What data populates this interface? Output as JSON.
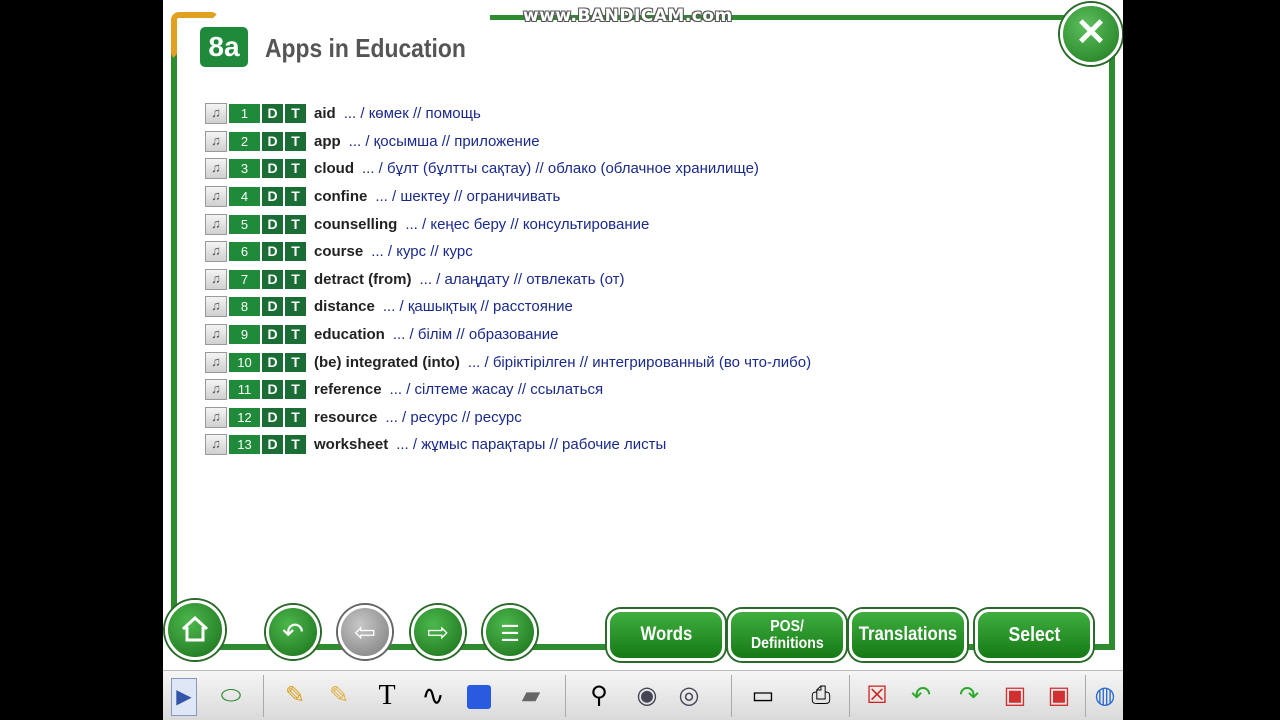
{
  "watermark": "www.BANDICAM.com",
  "unit": {
    "badge": "8a",
    "title": "Apps in Education"
  },
  "row_buttons": {
    "definition": "D",
    "translation": "T",
    "audio_icon": "headphones-icon"
  },
  "words": [
    {
      "num": "1",
      "word": "aid",
      "translation": "... / көмек // помощь"
    },
    {
      "num": "2",
      "word": "app",
      "translation": "... / қосымша // приложение"
    },
    {
      "num": "3",
      "word": "cloud",
      "translation": "... / бұлт (бұлтты сақтау) // облако (облачное хранилище)"
    },
    {
      "num": "4",
      "word": "confine",
      "translation": "... / шектеу // ограничивать"
    },
    {
      "num": "5",
      "word": "counselling",
      "translation": "... / кеңес беру // консультирование"
    },
    {
      "num": "6",
      "word": "course",
      "translation": "... / курс // курс"
    },
    {
      "num": "7",
      "word": "detract (from)",
      "translation": "... / алаңдату // отвлекать (от)"
    },
    {
      "num": "8",
      "word": "distance",
      "translation": "... / қашықтық // расстояние"
    },
    {
      "num": "9",
      "word": "education",
      "translation": "... / білім // образование"
    },
    {
      "num": "10",
      "word": "(be) integrated (into)",
      "translation": "... / біріктірілген // интегрированный (во что-либо)"
    },
    {
      "num": "11",
      "word": "reference",
      "translation": "... / сілтеме жасау // ссылаться"
    },
    {
      "num": "12",
      "word": "resource",
      "translation": "... / ресурс // ресурс"
    },
    {
      "num": "13",
      "word": "worksheet",
      "translation": "... / жұмыс парақтары // рабочие листы"
    }
  ],
  "nav": {
    "home_icon": "home-icon",
    "undo_icon": "undo-arrow-icon",
    "back_icon": "left-arrow-icon",
    "forward_icon": "right-arrow-icon",
    "clear_icon": "clear-list-icon",
    "close_icon": "close-icon"
  },
  "modes": {
    "words": "Words",
    "pos_line1": "POS/",
    "pos_line2": "Definitions",
    "translations": "Translations",
    "select": "Select"
  },
  "toolbar": {
    "icons": [
      "expand-arrow-icon",
      "mouse-pointer-icon",
      "pencil-icon",
      "highlighter-icon",
      "text-tool-icon",
      "freehand-icon",
      "shape-icon",
      "eraser-icon",
      "zoom-icon",
      "reveal-icon",
      "hide-icon",
      "blank-page-icon",
      "print-icon",
      "delete-icon",
      "undo-icon",
      "redo-icon",
      "save-icon",
      "save-as-icon",
      "globe-icon"
    ],
    "text_tool_label": "T"
  },
  "colors": {
    "accent_green": "#1f8a3a",
    "frame_green": "#2e8b2e",
    "translation_blue": "#1a2a8a"
  }
}
